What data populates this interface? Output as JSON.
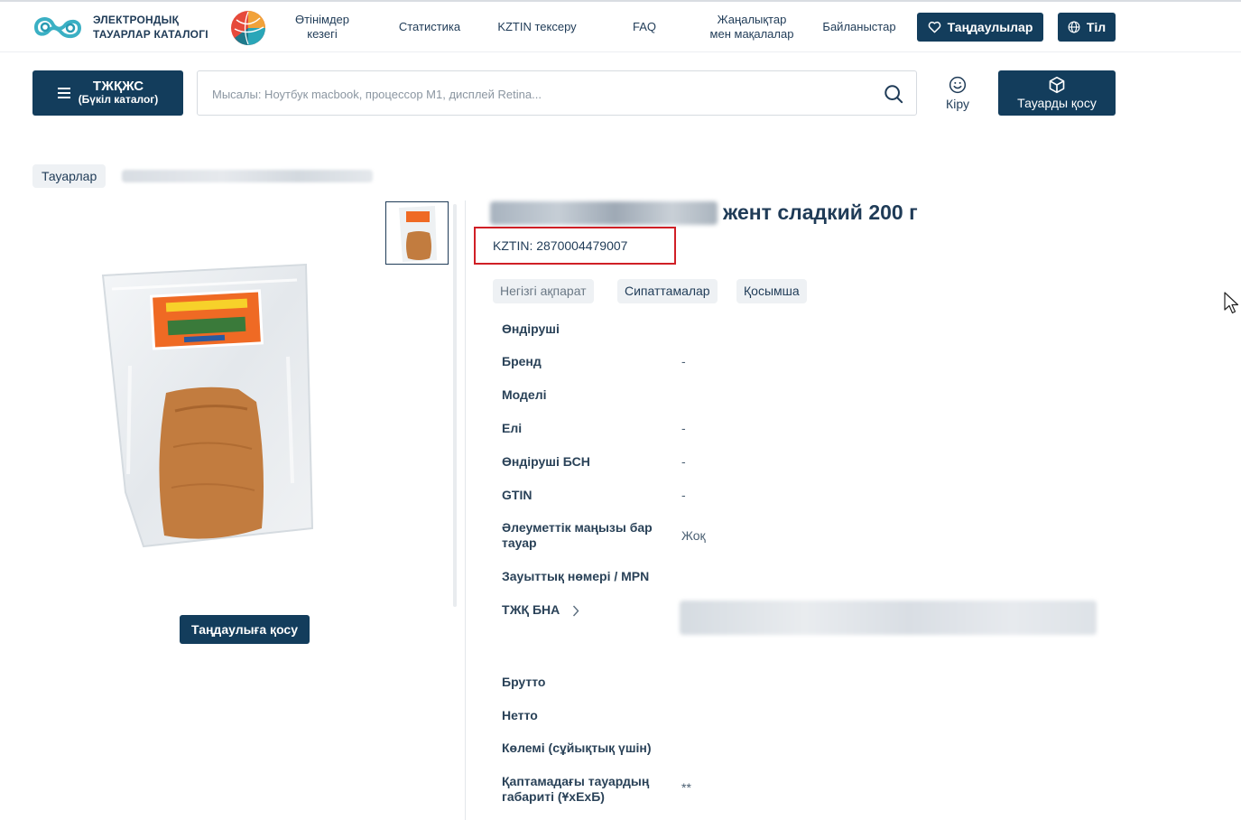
{
  "header": {
    "logo_line1": "ЭЛЕКТРОНДЫҚ",
    "logo_line2": "ТАУАРЛАР КАТАЛОГІ",
    "nav": [
      {
        "line1": "Өтінімдер",
        "line2": "кезегі"
      },
      {
        "line1": "Статистика",
        "line2": ""
      },
      {
        "line1": "KZTIN тексеру",
        "line2": ""
      },
      {
        "line1": "FAQ",
        "line2": ""
      },
      {
        "line1": "Жаңалықтар",
        "line2": "мен мақалалар"
      },
      {
        "line1": "Байланыстар",
        "line2": ""
      }
    ],
    "favorites_label": "Таңдаулылар",
    "language_label": "Тіл"
  },
  "toolbar": {
    "catalog_line1": "ТЖҚЖС",
    "catalog_line2": "(Бүкіл каталог)",
    "search_placeholder": "Мысалы: Ноутбук macbook, процессор M1, дисплей Retina...",
    "search_value": "",
    "login_label": "Кіру",
    "add_product_label": "Тауарды қосу"
  },
  "breadcrumb": {
    "home": "Тауарлар"
  },
  "gallery": {
    "add_to_favorites": "Таңдаулыға қосу"
  },
  "product": {
    "title_visible": "жент сладкий 200 г",
    "kztin": "KZTIN: 2870004479007",
    "tabs": [
      "Негізгі ақпарат",
      "Сипаттамалар",
      "Қосымша"
    ],
    "rows": [
      {
        "label": "Өндіруші",
        "value": ""
      },
      {
        "label": "Бренд",
        "value": "-"
      },
      {
        "label": "Моделі",
        "value": ""
      },
      {
        "label": "Елі",
        "value": "-"
      },
      {
        "label": "Өндіруші БСН",
        "value": "-"
      },
      {
        "label": "GTIN",
        "value": "-"
      },
      {
        "label": "Әлеуметтік маңызы бар тауар",
        "value": "Жоқ"
      },
      {
        "label": "Зауыттық нөмері / MPN",
        "value": ""
      },
      {
        "label": "ТЖҚ БНА",
        "value": ""
      },
      {
        "label": "Брутто",
        "value": ""
      },
      {
        "label": "Нетто",
        "value": ""
      },
      {
        "label": "Көлемі (сұйықтық үшін)",
        "value": ""
      },
      {
        "label": "Қаптамадағы тауардың габариті (ҰхЕхБ)",
        "value": "**"
      }
    ]
  },
  "colors": {
    "primary": "#133d5c",
    "text": "#1f3b57",
    "highlight_border": "#d01f26",
    "chip_bg": "#eef1f4"
  }
}
